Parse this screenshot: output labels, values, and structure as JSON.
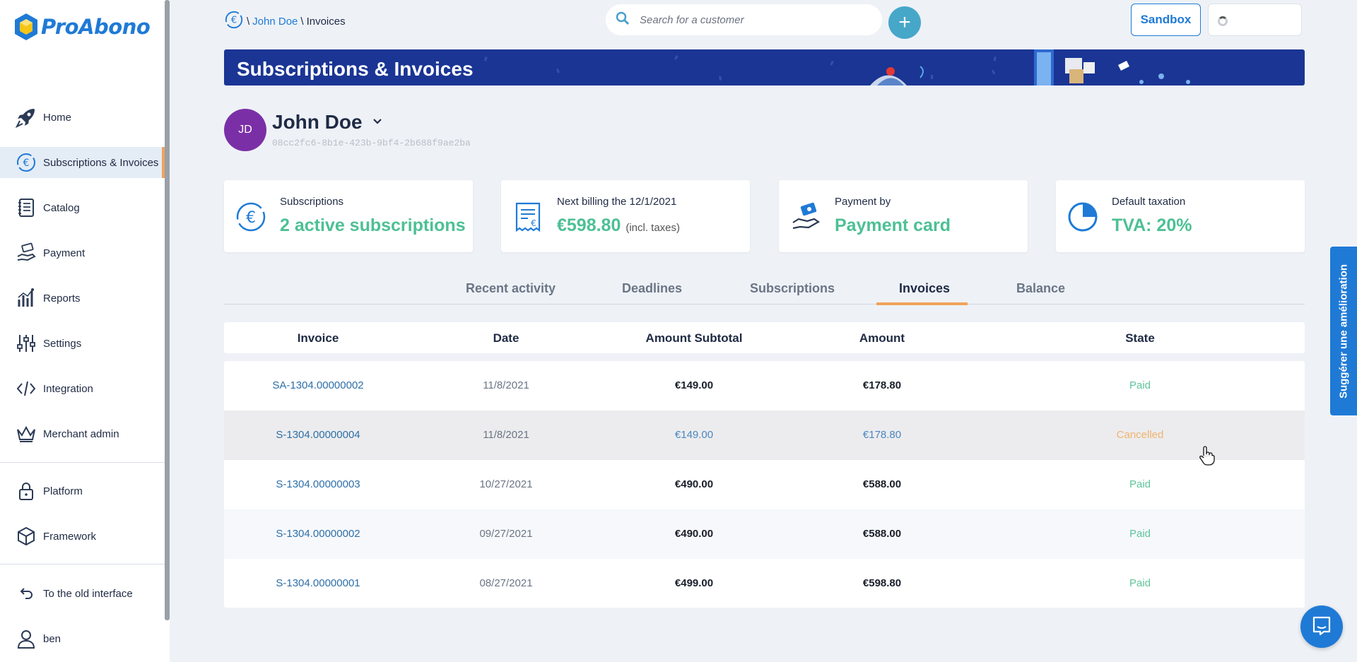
{
  "app": {
    "logo_text": "ProAbono",
    "brand_color": "#1f7ad6",
    "accent_color": "#f0a35a"
  },
  "sidebar": {
    "items": [
      {
        "label": "Home",
        "icon": "rocket-icon"
      },
      {
        "label": "Subscriptions & Invoices",
        "icon": "euro-cycle-icon",
        "active": true
      },
      {
        "label": "Catalog",
        "icon": "notebook-icon"
      },
      {
        "label": "Payment",
        "icon": "hand-money-icon"
      },
      {
        "label": "Reports",
        "icon": "chart-icon"
      },
      {
        "label": "Settings",
        "icon": "sliders-icon"
      },
      {
        "label": "Integration",
        "icon": "code-icon"
      },
      {
        "label": "Merchant admin",
        "icon": "crown-icon"
      },
      {
        "label": "Platform",
        "icon": "lock-icon"
      },
      {
        "label": "Framework",
        "icon": "cube-icon"
      },
      {
        "label": "To the old interface",
        "icon": "undo-icon"
      },
      {
        "label": "ben",
        "icon": "user-icon"
      }
    ]
  },
  "breadcrumb": {
    "sep": "\\",
    "customer": "John Doe",
    "current": "Invoices"
  },
  "search": {
    "placeholder": "Search for a customer"
  },
  "topbar": {
    "add_label": "+",
    "sandbox_label": "Sandbox"
  },
  "banner": {
    "title": "Subscriptions & Invoices"
  },
  "customer": {
    "initials": "JD",
    "name": "John Doe",
    "id": "08cc2fc6-8b1e-423b-9bf4-2b688f9ae2ba"
  },
  "cards": [
    {
      "label": "Subscriptions",
      "value": "2 active subscriptions",
      "suffix": "",
      "icon": "euro-cycle-icon"
    },
    {
      "label": "Next billing the 12/1/2021",
      "value": "€598.80",
      "suffix": "(incl. taxes)",
      "icon": "receipt-icon"
    },
    {
      "label": "Payment by",
      "value": "Payment card",
      "suffix": "",
      "icon": "hand-card-icon"
    },
    {
      "label": "Default taxation",
      "value": "TVA: 20%",
      "suffix": "",
      "icon": "pie-icon"
    }
  ],
  "tabs": [
    {
      "label": "Recent activity"
    },
    {
      "label": "Deadlines"
    },
    {
      "label": "Subscriptions"
    },
    {
      "label": "Invoices",
      "active": true
    },
    {
      "label": "Balance"
    }
  ],
  "table": {
    "columns": [
      "Invoice",
      "Date",
      "Amount Subtotal",
      "Amount",
      "State"
    ],
    "rows": [
      {
        "invoice": "SA-1304.00000002",
        "date": "11/8/2021",
        "subtotal": "€149.00",
        "amount": "€178.80",
        "state": "Paid"
      },
      {
        "invoice": "S-1304.00000004",
        "date": "11/8/2021",
        "subtotal": "€149.00",
        "amount": "€178.80",
        "state": "Cancelled"
      },
      {
        "invoice": "S-1304.00000003",
        "date": "10/27/2021",
        "subtotal": "€490.00",
        "amount": "€588.00",
        "state": "Paid"
      },
      {
        "invoice": "S-1304.00000002",
        "date": "09/27/2021",
        "subtotal": "€490.00",
        "amount": "€588.00",
        "state": "Paid"
      },
      {
        "invoice": "S-1304.00000001",
        "date": "08/27/2021",
        "subtotal": "€499.00",
        "amount": "€598.80",
        "state": "Paid"
      }
    ]
  },
  "feedback": {
    "label": "Suggérer une amélioration"
  }
}
